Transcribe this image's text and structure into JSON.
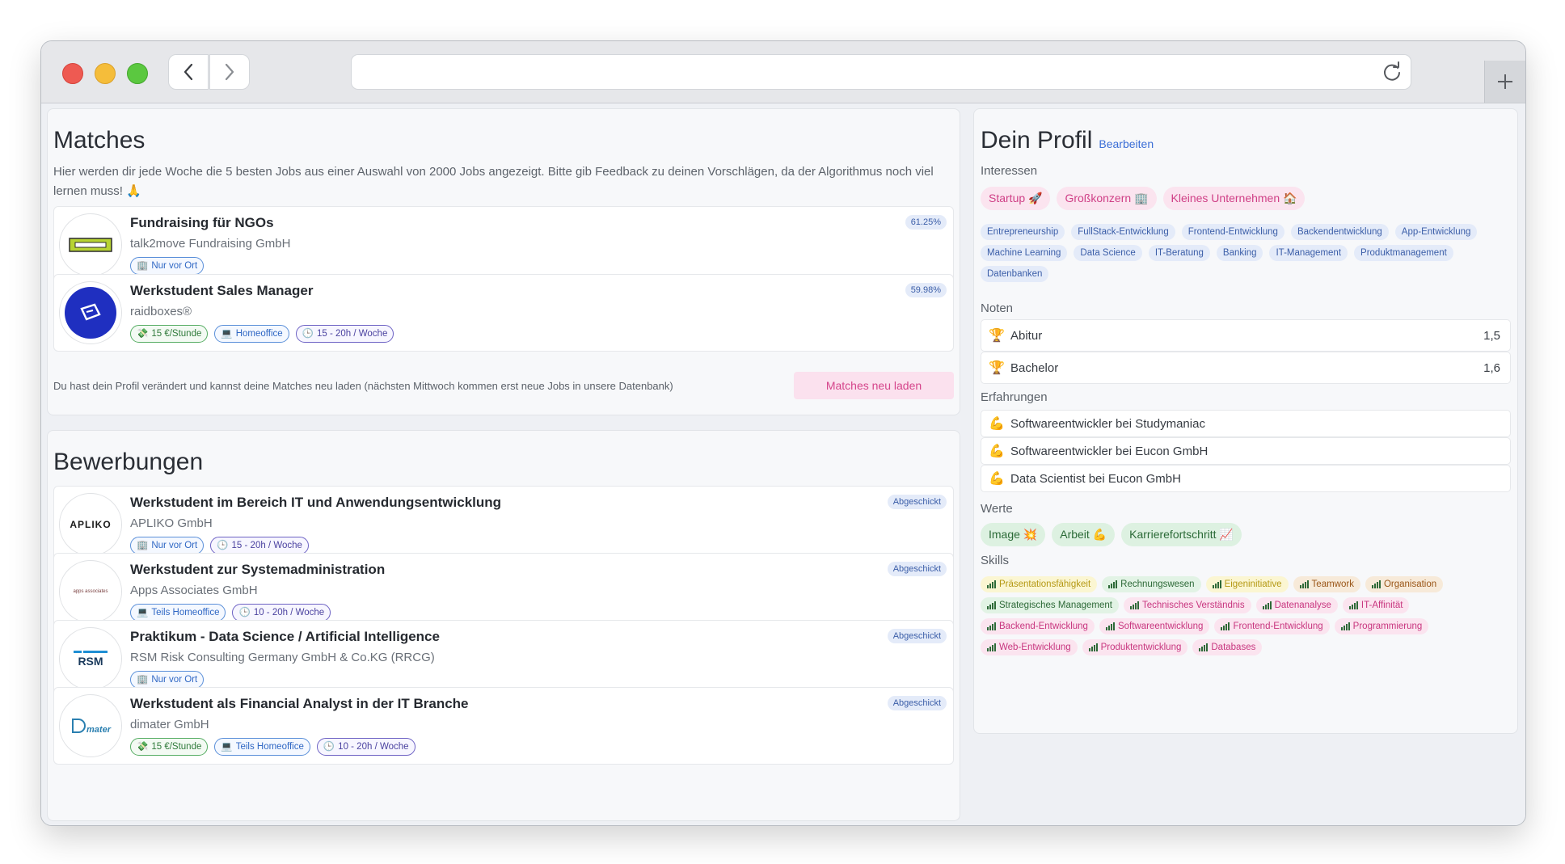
{
  "matches": {
    "title": "Matches",
    "intro": "Hier werden dir jede Woche die 5 besten Jobs aus einer Auswahl von 2000 Jobs angezeigt. Bitte gib Feedback zu deinen Vorschlägen, da der Algorithmus noch viel lernen muss! 🙏",
    "items": [
      {
        "title": "Fundraising für NGOs",
        "company": "talk2move Fundraising GmbH",
        "score": "61.25%",
        "tags": [
          "Nur vor Ort"
        ]
      },
      {
        "title": "Werkstudent Sales Manager",
        "company": "raidboxes®",
        "score": "59.98%",
        "tags": [
          "15 €/Stunde",
          "Homeoffice",
          "15 - 20h / Woche"
        ]
      }
    ],
    "reload_text": "Du hast dein Profil verändert und kannst deine Matches neu laden (nächsten Mittwoch kommen erst neue Jobs in unsere Datenbank)",
    "reload_button": "Matches neu laden"
  },
  "applications": {
    "title": "Bewerbungen",
    "items": [
      {
        "title": "Werkstudent im Bereich IT und Anwendungsentwicklung",
        "company": "APLIKO GmbH",
        "status": "Abgeschickt",
        "logo_text": "APLIKO",
        "tags": [
          "Nur vor Ort",
          "15 - 20h / Woche"
        ]
      },
      {
        "title": "Werkstudent zur Systemadministration",
        "company": "Apps Associates GmbH",
        "status": "Abgeschickt",
        "logo_text": "apps associates",
        "tags": [
          "Teils Homeoffice",
          "10 - 20h / Woche"
        ]
      },
      {
        "title": "Praktikum - Data Science / Artificial Intelligence",
        "company": "RSM Risk Consulting Germany GmbH & Co.KG (RRCG)",
        "status": "Abgeschickt",
        "logo_text": "RSM",
        "tags": [
          "Nur vor Ort"
        ]
      },
      {
        "title": "Werkstudent als Financial Analyst in der IT Branche",
        "company": "dimater GmbH",
        "status": "Abgeschickt",
        "logo_text": "mater",
        "tags": [
          "15 €/Stunde",
          "Teils Homeoffice",
          "10 - 20h / Woche"
        ]
      }
    ]
  },
  "profile": {
    "title": "Dein Profil",
    "edit_link": "Bearbeiten",
    "interests_label": "Interessen",
    "company_types": [
      "Startup 🚀",
      "Großkonzern 🏢",
      "Kleines Unternehmen 🏠"
    ],
    "fields": [
      "Entrepreneurship",
      "FullStack-Entwicklung",
      "Frontend-Entwicklung",
      "Backendentwicklung",
      "App-Entwicklung",
      "Machine Learning",
      "Data Science",
      "IT-Beratung",
      "Banking",
      "IT-Management",
      "Produktmanagement",
      "Datenbanken"
    ],
    "grades_label": "Noten",
    "grades": [
      {
        "label": "Abitur",
        "value": "1,5"
      },
      {
        "label": "Bachelor",
        "value": "1,6"
      }
    ],
    "experience_label": "Erfahrungen",
    "experiences": [
      "Softwareentwickler bei Studymaniac",
      "Softwareentwickler bei Eucon GmbH",
      "Data Scientist bei Eucon GmbH"
    ],
    "values_label": "Werte",
    "values": [
      "Image 💥",
      "Arbeit 💪",
      "Karrierefortschritt 📈"
    ],
    "skills_label": "Skills",
    "skills": [
      {
        "name": "Präsentationsfähigkeit",
        "color": "yellow"
      },
      {
        "name": "Rechnungswesen",
        "color": "green"
      },
      {
        "name": "Eigeninitiative",
        "color": "yellow"
      },
      {
        "name": "Teamwork",
        "color": "orange"
      },
      {
        "name": "Organisation",
        "color": "orange"
      },
      {
        "name": "Strategisches Management",
        "color": "green"
      },
      {
        "name": "Technisches Verständnis",
        "color": "pink"
      },
      {
        "name": "Datenanalyse",
        "color": "pink"
      },
      {
        "name": "IT-Affinität",
        "color": "pink"
      },
      {
        "name": "Backend-Entwicklung",
        "color": "pink"
      },
      {
        "name": "Softwareentwicklung",
        "color": "pink"
      },
      {
        "name": "Frontend-Entwicklung",
        "color": "pink"
      },
      {
        "name": "Programmierung",
        "color": "pink"
      },
      {
        "name": "Web-Entwicklung",
        "color": "pink"
      },
      {
        "name": "Produktentwicklung",
        "color": "pink"
      },
      {
        "name": "Databases",
        "color": "pink"
      }
    ]
  }
}
